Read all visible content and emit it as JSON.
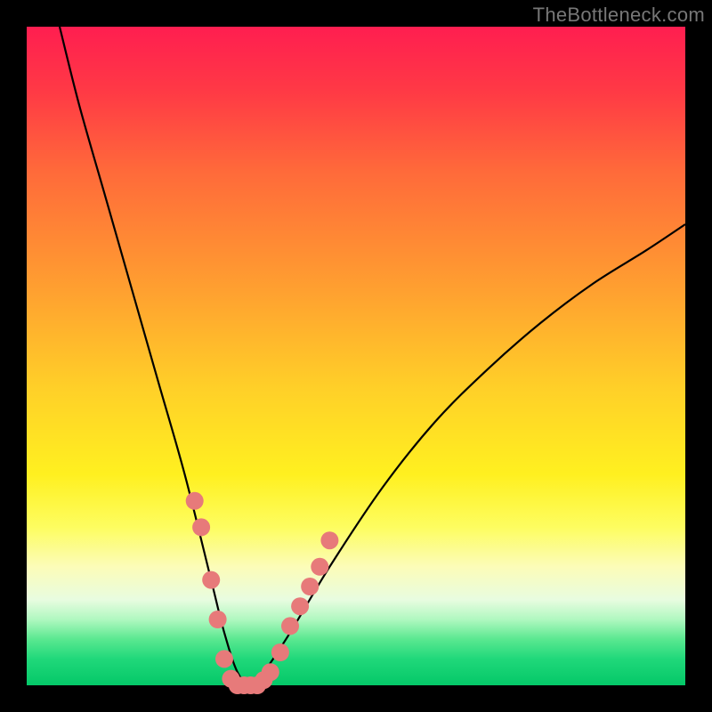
{
  "watermark": "TheBottleneck.com",
  "chart_data": {
    "type": "line",
    "title": "",
    "xlabel": "",
    "ylabel": "",
    "xlim": [
      0,
      100
    ],
    "ylim": [
      0,
      100
    ],
    "series": [
      {
        "name": "bottleneck-curve",
        "x": [
          5,
          8,
          12,
          16,
          20,
          24,
          28,
          30,
          32,
          34,
          36,
          40,
          46,
          54,
          62,
          70,
          78,
          86,
          94,
          100
        ],
        "y": [
          100,
          88,
          74,
          60,
          46,
          32,
          16,
          8,
          2,
          0,
          2,
          8,
          18,
          30,
          40,
          48,
          55,
          61,
          66,
          70
        ]
      }
    ],
    "markers": {
      "name": "highlight-dots",
      "color": "#e77a7a",
      "x": [
        25.5,
        26.5,
        28,
        29,
        30,
        31,
        32,
        33,
        34,
        35,
        36,
        37,
        38.5,
        40,
        41.5,
        43,
        44.5,
        46
      ],
      "y": [
        28,
        24,
        16,
        10,
        4,
        1,
        0,
        0,
        0,
        0,
        0.8,
        2,
        5,
        9,
        12,
        15,
        18,
        22
      ]
    },
    "gradient_stops": [
      {
        "pos": 0,
        "color": "#ff1e50"
      },
      {
        "pos": 10,
        "color": "#ff3a45"
      },
      {
        "pos": 22,
        "color": "#ff6a3a"
      },
      {
        "pos": 40,
        "color": "#ffa030"
      },
      {
        "pos": 55,
        "color": "#ffd028"
      },
      {
        "pos": 68,
        "color": "#fff020"
      },
      {
        "pos": 76,
        "color": "#fdfd60"
      },
      {
        "pos": 82,
        "color": "#fcfcb8"
      },
      {
        "pos": 87,
        "color": "#e8fce0"
      },
      {
        "pos": 90,
        "color": "#b0f8c0"
      },
      {
        "pos": 93,
        "color": "#5ae890"
      },
      {
        "pos": 96,
        "color": "#20d87a"
      },
      {
        "pos": 100,
        "color": "#04c868"
      }
    ]
  }
}
